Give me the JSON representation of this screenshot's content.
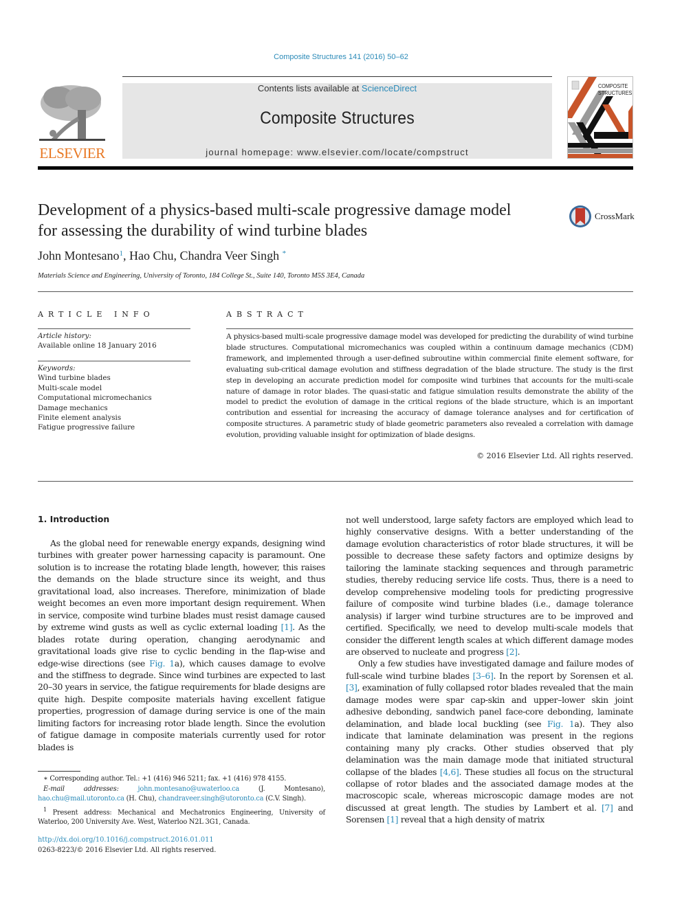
{
  "journal_reference": "Composite Structures 141 (2016) 50–62",
  "masthead": {
    "contents_prefix": "Contents lists available at ",
    "contents_link": "ScienceDirect",
    "journal_title": "Composite Structures",
    "homepage_prefix": "journal homepage: ",
    "homepage_url": "www.elsevier.com/locate/compstruct",
    "publisher_logo_text": "ELSEVIER",
    "cover_title_line1": "COMPOSITE",
    "cover_title_line2": "STRUCTURES"
  },
  "colors": {
    "link": "#2a8ab8",
    "elsevier_orange": "#e87722",
    "cover_orange": "#c8552a",
    "cover_gray": "#9a9a9a",
    "crossmark_red": "#c0392b"
  },
  "article": {
    "title_line1": "Development of a physics-based multi-scale progressive damage model",
    "title_line2": "for assessing the durability of wind turbine blades",
    "crossmark_label": "CrossMark",
    "authors": [
      {
        "name": "John Montesano",
        "mark": "1",
        "sep": ", "
      },
      {
        "name": "Hao Chu",
        "mark": "",
        "sep": ", "
      },
      {
        "name": "Chandra Veer Singh",
        "mark": "*",
        "sep": ""
      }
    ],
    "affiliation": "Materials Science and Engineering, University of Toronto, 184 College St., Suite 140, Toronto M5S 3E4, Canada"
  },
  "article_info": {
    "heading": "ARTICLE INFO",
    "history_label": "Article history:",
    "history_value": "Available online 18 January 2016",
    "keywords_label": "Keywords:",
    "keywords": [
      "Wind turbine blades",
      "Multi-scale model",
      "Computational micromechanics",
      "Damage mechanics",
      "Finite element analysis",
      "Fatigue progressive failure"
    ]
  },
  "abstract": {
    "heading": "ABSTRACT",
    "text": "A physics-based multi-scale progressive damage model was developed for predicting the durability of wind turbine blade structures. Computational micromechanics was coupled within a continuum damage mechanics (CDM) framework, and implemented through a user-defined subroutine within commercial finite element software, for evaluating sub-critical damage evolution and stiffness degradation of the blade structure. The study is the first step in developing an accurate prediction model for composite wind turbines that accounts for the multi-scale nature of damage in rotor blades. The quasi-static and fatigue simulation results demonstrate the ability of the model to predict the evolution of damage in the critical regions of the blade structure, which is an important contribution and essential for increasing the accuracy of damage tolerance analyses and for certification of composite structures. A parametric study of blade geometric parameters also revealed a correlation with damage evolution, providing valuable insight for optimization of blade designs.",
    "copyright": "© 2016 Elsevier Ltd. All rights reserved."
  },
  "body": {
    "section_heading": "1. Introduction",
    "left_para": [
      {
        "t": "As the global need for renewable energy expands, designing wind turbines with greater power harnessing capacity is paramount. One solution is to increase the rotating blade length, however, this raises the demands on the blade structure since its weight, and thus gravitational load, also increases. Therefore, minimization of blade weight becomes an even more important design requirement. When in service, composite wind turbine blades must resist damage caused by extreme wind gusts as well as cyclic external loading "
      },
      {
        "link": "[1]"
      },
      {
        "t": ". As the blades rotate during operation, changing aerodynamic and gravitational loads give rise to cyclic bending in the flap-wise and edge-wise directions (see "
      },
      {
        "link": "Fig. 1"
      },
      {
        "t": "a), which causes damage to evolve and the stiffness to degrade. Since wind turbines are expected to last 20–30 years in service, the fatigue requirements for blade designs are quite high. Despite composite materials having excellent fatigue properties, progression of damage during service is one of the main limiting factors for increasing rotor blade length. Since the evolution of fatigue damage in composite materials currently used for rotor blades is"
      }
    ],
    "right_para1": [
      {
        "t": "not well understood, large safety factors are employed which lead to highly conservative designs. With a better understanding of the damage evolution characteristics of rotor blade structures, it will be possible to decrease these safety factors and optimize designs by tailoring the laminate stacking sequences and through parametric studies, thereby reducing service life costs. Thus, there is a need to develop comprehensive modeling tools for predicting progressive failure of composite wind turbine blades (i.e., damage tolerance analysis) if larger wind turbine structures are to be improved and certified. Specifically, we need to develop multi-scale models that consider the different length scales at which different damage modes are observed to nucleate and progress "
      },
      {
        "link": "[2]"
      },
      {
        "t": "."
      }
    ],
    "right_para2": [
      {
        "t": "Only a few studies have investigated damage and failure modes of full-scale wind turbine blades "
      },
      {
        "link": "[3–6]"
      },
      {
        "t": ". In the report by Sorensen et al. "
      },
      {
        "link": "[3]"
      },
      {
        "t": ", examination of fully collapsed rotor blades revealed that the main damage modes were spar cap-skin and upper–lower skin joint adhesive debonding, sandwich panel face-core debonding, laminate delamination, and blade local buckling (see "
      },
      {
        "link": "Fig. 1"
      },
      {
        "t": "a). They also indicate that laminate delamination was present in the regions containing many ply cracks. Other studies observed that ply delamination was the main damage mode that initiated structural collapse of the blades "
      },
      {
        "link": "[4,6]"
      },
      {
        "t": ". These studies all focus on the structural collapse of rotor blades and the associated damage modes at the macroscopic scale, whereas microscopic damage modes are not discussed at great length. The studies by Lambert et al. "
      },
      {
        "link": "[7]"
      },
      {
        "t": " and Sorensen "
      },
      {
        "link": "[1]"
      },
      {
        "t": " reveal that a high density of matrix"
      }
    ]
  },
  "footnotes": {
    "corresponding": "∗ Corresponding author. Tel.: +1 (416) 946 5211; fax. +1 (416) 978 4155.",
    "email_label": "E-mail addresses: ",
    "emails": [
      {
        "addr": "john.montesano@uwaterloo.ca",
        "who": " (J. Montesano), "
      },
      {
        "addr": "hao.chu@mail.utoronto.ca",
        "who": " (H. Chu), "
      },
      {
        "addr": "chandraveer.singh@utoronto.ca",
        "who": " (C.V. Singh)."
      }
    ],
    "present_address_mark": "1",
    "present_address": " Present address: Mechanical and Mechatronics Engineering, University of Waterloo, 200 University Ave. West, Waterloo N2L 3G1, Canada.",
    "doi": "http://dx.doi.org/10.1016/j.compstruct.2016.01.011",
    "issn_line": "0263-8223/© 2016 Elsevier Ltd. All rights reserved."
  }
}
